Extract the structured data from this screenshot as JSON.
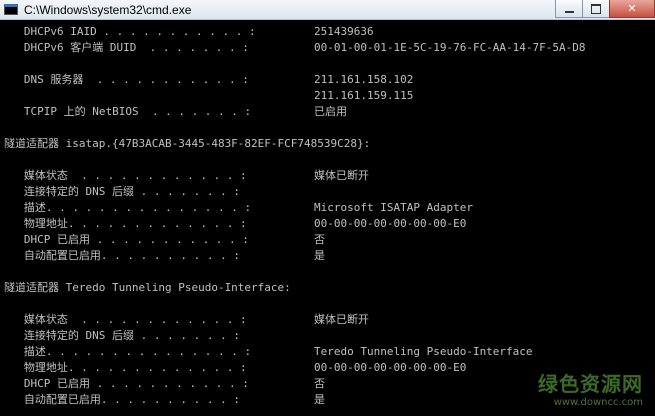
{
  "window": {
    "title": "C:\\Windows\\system32\\cmd.exe",
    "close_glyph": "✕"
  },
  "rows": [
    {
      "label": "   DHCPv6 IAID . . . . . . . . . . . : ",
      "value": "251439636"
    },
    {
      "label": "   DHCPv6 客户端 DUID  . . . . . . . : ",
      "value": "00-01-00-01-1E-5C-19-76-FC-AA-14-7F-5A-D8"
    },
    {
      "label": "",
      "value": ""
    },
    {
      "label": "   DNS 服务器  . . . . . . . . . . . : ",
      "value": "211.161.158.102"
    },
    {
      "label": "",
      "value": "211.161.159.115"
    },
    {
      "label": "   TCPIP 上的 NetBIOS  . . . . . . . : ",
      "value": "已启用"
    },
    {
      "label": "",
      "value": ""
    },
    {
      "label": "隧道适配器 isatap.{47B3ACAB-3445-483F-82EF-FCF748539C28}:",
      "value": ""
    },
    {
      "label": "",
      "value": ""
    },
    {
      "label": "   媒体状态  . . . . . . . . . . . . : ",
      "value": "媒体已断开"
    },
    {
      "label": "   连接特定的 DNS 后缀 . . . . . . . : ",
      "value": ""
    },
    {
      "label": "   描述. . . . . . . . . . . . . . . : ",
      "value": "Microsoft ISATAP Adapter"
    },
    {
      "label": "   物理地址. . . . . . . . . . . . . : ",
      "value": "00-00-00-00-00-00-00-E0"
    },
    {
      "label": "   DHCP 已启用 . . . . . . . . . . . : ",
      "value": "否"
    },
    {
      "label": "   自动配置已启用. . . . . . . . . . : ",
      "value": "是"
    },
    {
      "label": "",
      "value": ""
    },
    {
      "label": "隧道适配器 Teredo Tunneling Pseudo-Interface:",
      "value": ""
    },
    {
      "label": "",
      "value": ""
    },
    {
      "label": "   媒体状态  . . . . . . . . . . . . : ",
      "value": "媒体已断开"
    },
    {
      "label": "   连接特定的 DNS 后缀 . . . . . . . : ",
      "value": ""
    },
    {
      "label": "   描述. . . . . . . . . . . . . . . : ",
      "value": "Teredo Tunneling Pseudo-Interface"
    },
    {
      "label": "   物理地址. . . . . . . . . . . . . : ",
      "value": "00-00-00-00-00-00-00-E0"
    },
    {
      "label": "   DHCP 已启用 . . . . . . . . . . . : ",
      "value": "否"
    },
    {
      "label": "   自动配置已启用. . . . . . . . . . : ",
      "value": "是"
    }
  ],
  "watermark": {
    "main": "绿色资源网",
    "sub": "www.downcc.com"
  }
}
